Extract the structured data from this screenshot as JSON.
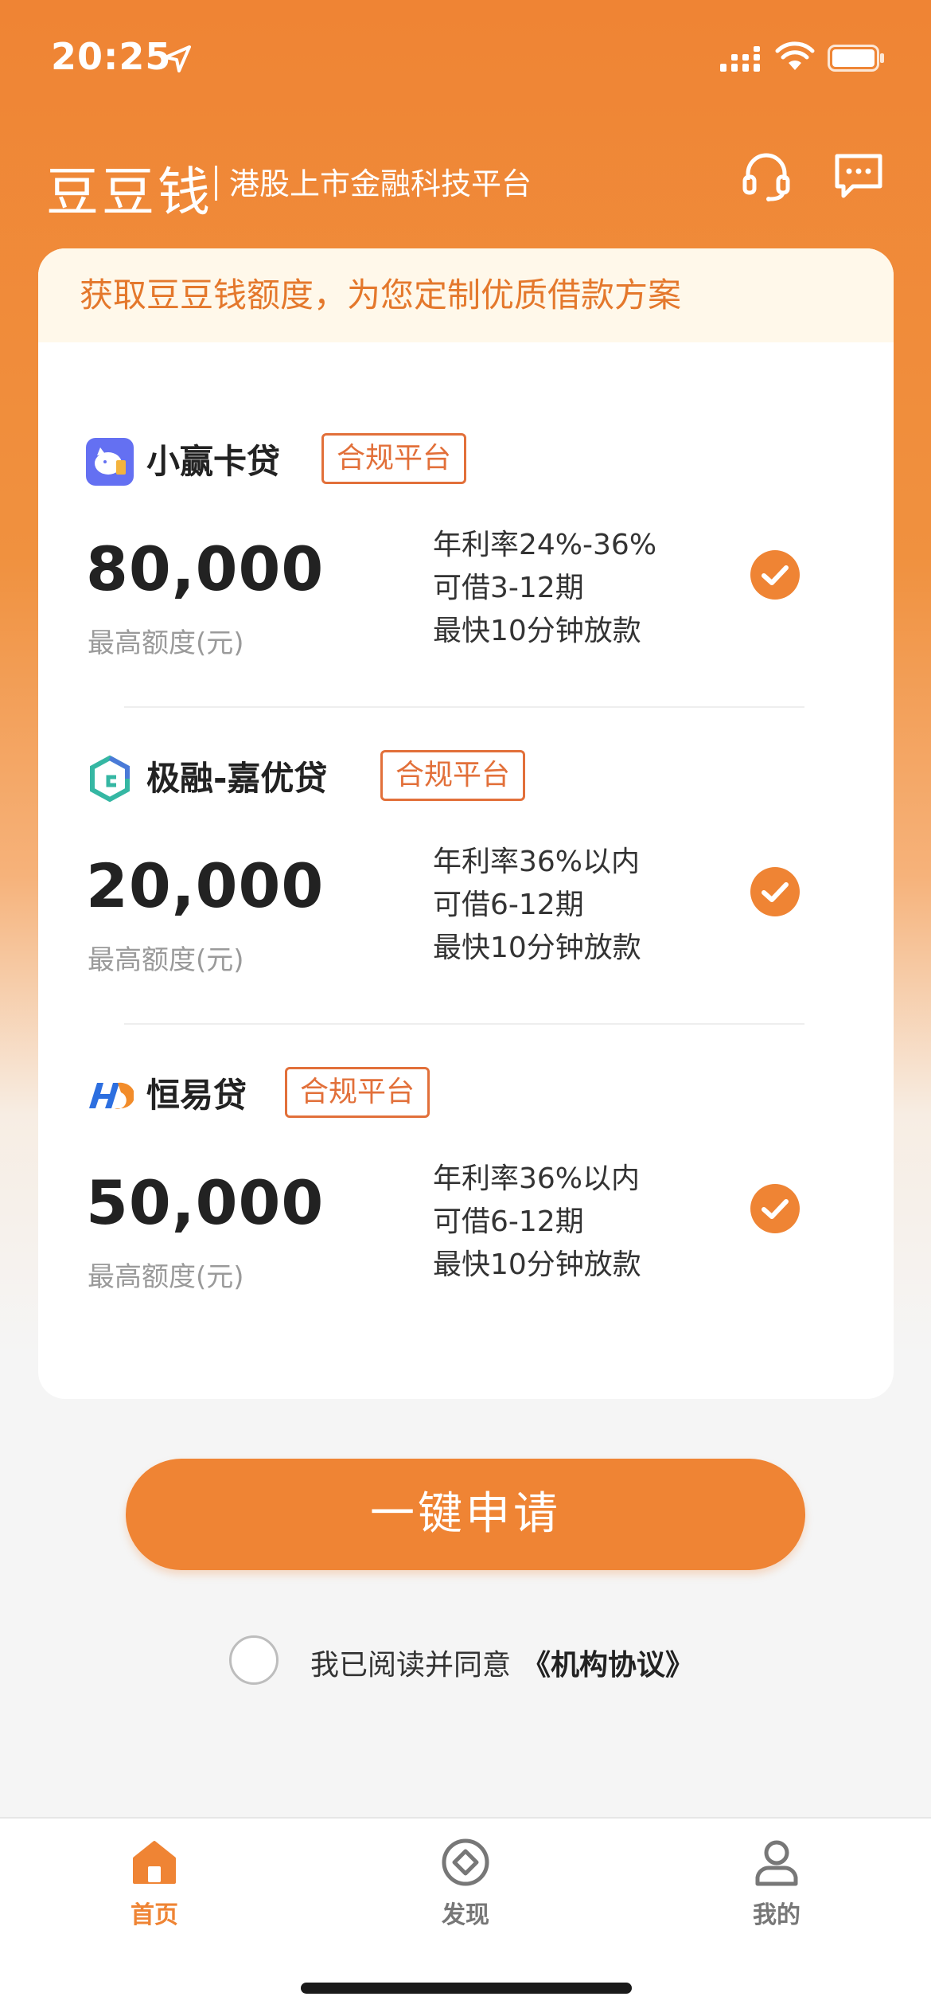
{
  "status_bar": {
    "time": "20:25"
  },
  "header": {
    "brand": "豆豆钱",
    "slogan": "港股上市金融科技平台"
  },
  "banner": {
    "text": "获取豆豆钱额度，为您定制优质借款方案"
  },
  "loans": [
    {
      "name": "小赢卡贷",
      "badge": "合规平台",
      "amount": "80,000",
      "amount_label": "最高额度(元)",
      "rate": "年利率24%-36%",
      "term": "可借3-12期",
      "speed": "最快10分钟放款",
      "selected": true
    },
    {
      "name": "极融-嘉优贷",
      "badge": "合规平台",
      "amount": "20,000",
      "amount_label": "最高额度(元)",
      "rate": "年利率36%以内",
      "term": "可借6-12期",
      "speed": "最快10分钟放款",
      "selected": true
    },
    {
      "name": "恒易贷",
      "badge": "合规平台",
      "amount": "50,000",
      "amount_label": "最高额度(元)",
      "rate": "年利率36%以内",
      "term": "可借6-12期",
      "speed": "最快10分钟放款",
      "selected": true
    }
  ],
  "apply_button": {
    "label": "一键申请"
  },
  "agreement": {
    "text": "我已阅读并同意",
    "link": "《机构协议》",
    "checked": false
  },
  "tabs": [
    {
      "label": "首页",
      "icon": "home-icon",
      "active": true
    },
    {
      "label": "发现",
      "icon": "discover-icon",
      "active": false
    },
    {
      "label": "我的",
      "icon": "profile-icon",
      "active": false
    }
  ],
  "colors": {
    "accent": "#ef8434",
    "badge": "#e2703a",
    "banner_text": "#e4782c",
    "tab_inactive": "#777777"
  }
}
